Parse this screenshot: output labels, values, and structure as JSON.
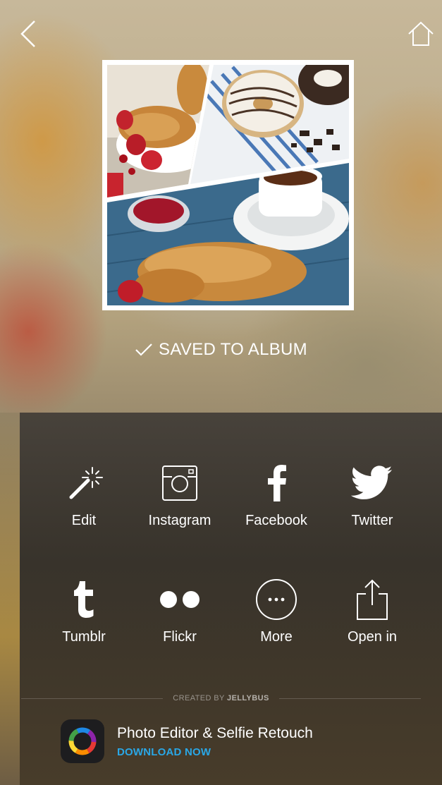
{
  "nav": {
    "back_icon": "chevron-left-icon",
    "home_icon": "home-icon"
  },
  "status": {
    "saved_icon": "checkmark-icon",
    "saved_text": "SAVED TO ALBUM"
  },
  "share": {
    "items": [
      {
        "label": "Edit",
        "icon": "magic-wand-icon"
      },
      {
        "label": "Instagram",
        "icon": "instagram-icon"
      },
      {
        "label": "Facebook",
        "icon": "facebook-icon"
      },
      {
        "label": "Twitter",
        "icon": "twitter-icon"
      },
      {
        "label": "Tumblr",
        "icon": "tumblr-icon"
      },
      {
        "label": "Flickr",
        "icon": "flickr-icon"
      },
      {
        "label": "More",
        "icon": "more-icon"
      },
      {
        "label": "Open in",
        "icon": "share-icon"
      }
    ]
  },
  "credit": {
    "prefix": "CREATED BY",
    "brand": "JELLYBUS"
  },
  "promo": {
    "title": "Photo Editor & Selfie Retouch",
    "cta": "DOWNLOAD NOW",
    "cta_color": "#2aa7e6"
  }
}
